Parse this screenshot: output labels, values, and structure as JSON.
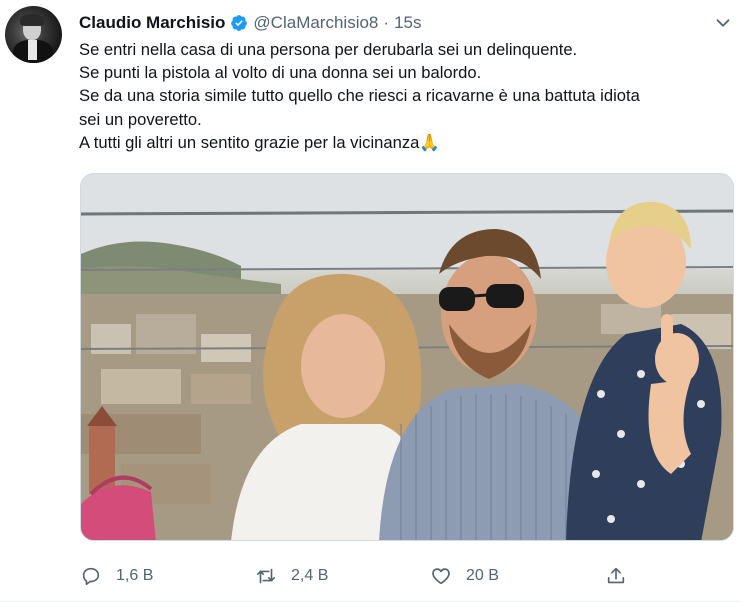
{
  "tweet": {
    "author_name": "Claudio Marchisio",
    "handle": "@ClaMarchisio8",
    "separator": "·",
    "time": "15s",
    "lines": [
      "Se entri nella casa di una persona per derubarla sei un delinquente.",
      "Se punti la pistola al volto di una donna sei un balordo.",
      "Se da una storia simile tutto quello che riesci a ricavarne è una battuta idiota",
      "sei un poveretto.",
      "A tutti gli altri un sentito grazie per la vicinanza🙏"
    ]
  },
  "actions": {
    "reply_count": "1,6 B",
    "retweet_count": "2,4 B",
    "like_count": "20 B"
  },
  "icons": {
    "verified": "verified-badge-icon",
    "caret": "chevron-down-icon",
    "reply": "reply-icon",
    "retweet": "retweet-icon",
    "like": "heart-icon",
    "share": "share-icon"
  },
  "colors": {
    "verified_blue": "#1d9bf0",
    "text": "#0f1419",
    "muted": "#536471"
  }
}
